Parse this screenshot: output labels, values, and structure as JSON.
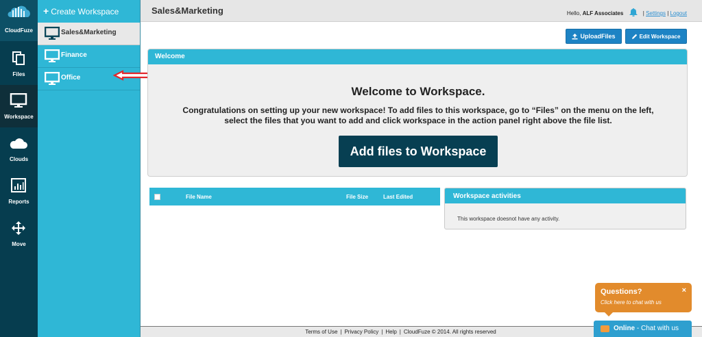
{
  "brand": {
    "name": "CloudFuze"
  },
  "rail": {
    "items": [
      {
        "label": "Files",
        "icon": "files-icon"
      },
      {
        "label": "Workspace",
        "icon": "monitor-icon",
        "active": true
      },
      {
        "label": "Clouds",
        "icon": "cloud-icon"
      },
      {
        "label": "Reports",
        "icon": "bar-chart-icon"
      },
      {
        "label": "Move",
        "icon": "move-arrows-icon"
      }
    ]
  },
  "workspaces": {
    "create_label": "Create Workspace",
    "create_icon": "plus-icon",
    "items": [
      {
        "label": "Sales&Marketing",
        "selected": true
      },
      {
        "label": "Finance"
      },
      {
        "label": "Office"
      }
    ]
  },
  "header": {
    "title": "Sales&Marketing",
    "greeting": "Hello,",
    "user": "ALF Associates",
    "bell_icon": "bell-icon",
    "settings": "Settings",
    "divider": "|",
    "logout": "Logout"
  },
  "actions": {
    "upload": "UploadFiles",
    "upload_icon": "upload-icon",
    "edit": "Edit Workspace",
    "edit_icon": "pencil-icon"
  },
  "welcome": {
    "header": "Welcome",
    "title": "Welcome to Workspace.",
    "line1": "Congratulations on setting up your new workspace! To add files to this workspace, go to “Files” on the menu on the left,",
    "line2": "select the files that you want to add and click workspace in the action panel right above the file list.",
    "button": "Add files to Workspace"
  },
  "files_table": {
    "columns": [
      "File Name",
      "File Size",
      "Last Edited"
    ]
  },
  "activities": {
    "header": "Workspace activities",
    "empty": "This workspace doesnot have any activity."
  },
  "footer": {
    "terms": "Terms of Use",
    "privacy": "Privacy Policy",
    "help": "Help",
    "copyright": "CloudFuze © 2014. All rights reserved",
    "sep": "|"
  },
  "chat": {
    "question": "Questions?",
    "prompt": "Click here to chat with us",
    "close": "×",
    "status": "Online",
    "status_suffix": "- Chat with us"
  },
  "colors": {
    "rail_bg": "#063d4f",
    "accent": "#2fb7d6",
    "primary_button": "#1d83c4",
    "cta_button": "#073f52",
    "chat_orange": "#e28b2c",
    "chat_blue": "#2e9fcf",
    "annotation_arrow": "#e2262b"
  }
}
